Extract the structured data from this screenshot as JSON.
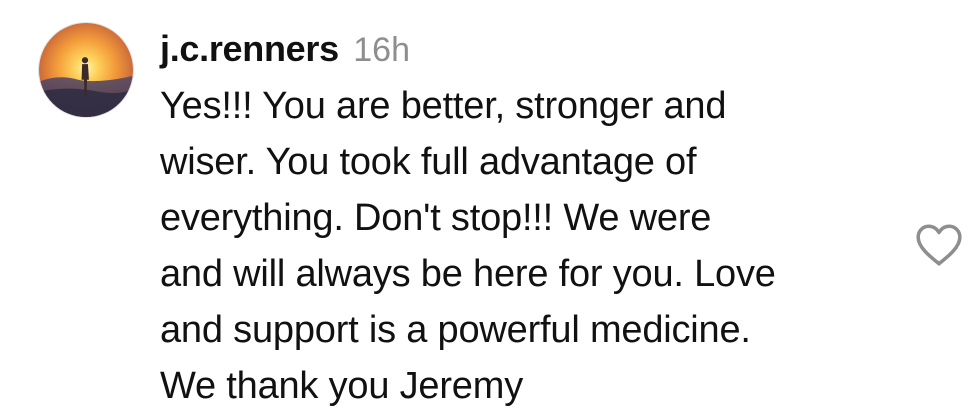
{
  "comment": {
    "username": "j.c.renners",
    "timestamp": "16h",
    "text_lines": [
      "Yes!!! You are better, stronger and",
      "wiser. You took full advantage of",
      "everything. Don't stop!!! We were",
      "and will always be here for you. Love",
      "and support is a powerful medicine.",
      "We thank you Jeremy"
    ],
    "avatar_icon": "sunset-silhouette-avatar",
    "like_icon": "heart-outline-icon"
  },
  "colors": {
    "text": "#111111",
    "timestamp": "#8e8e8e",
    "icon_stroke": "#8e8e8e"
  }
}
